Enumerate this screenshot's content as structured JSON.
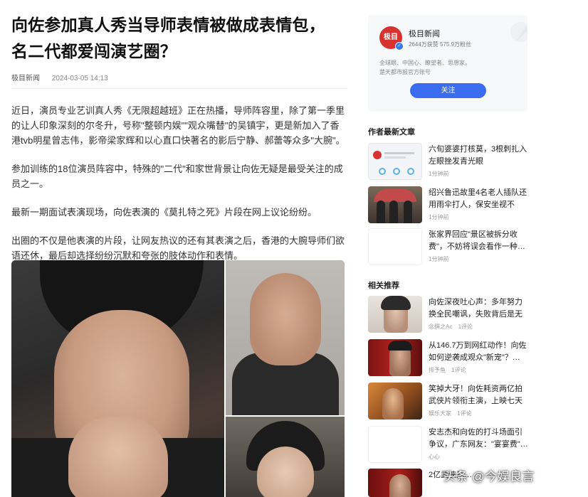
{
  "article": {
    "title_line1": "向佐参加真人秀当导师表情被做成表情包，",
    "title_line2": "名二代都爱闯演艺圈？",
    "source": "极目新闻",
    "date": "2024-03-05 14:13",
    "paragraphs": [
      "近日，演员专业艺训真人秀《无限超越班》正在热播，导师阵容里，除了第一季里的让人印象深刻的尔冬升，号称\"整顿内娱\"\"观众嘴替\"的吴镇宇，更是新加入了香港tvb明星曾志伟，影帝梁家辉和以心直口快著名的影后宁静、郝蕾等众多\"大腕\"。",
      "参加训练的18位演员阵容中，特殊的\"二代\"和家世背景让向佐无疑是最受关注的成员之一。",
      "最新一期面试表演现场，向佐表演的《莫扎特之死》片段在网上议论纷纷。",
      "出圈的不仅是他表演的片段，让网友热议的还有其表演之后，香港的大腕导师们欲语还休，最后却选择纷纷沉默和夸张的肢体动作和表情。"
    ]
  },
  "author_card": {
    "logo_text": "极目",
    "name": "极目新闻",
    "stats": "2644万获赞 575.9万粉丝",
    "desc_line1": "全球眼、中国心、瞭望者、思想家。",
    "desc_line2": "楚天都市报官方账号",
    "follow_label": "关注"
  },
  "latest": {
    "heading": "作者最新文章",
    "items": [
      {
        "title": "六旬婆婆打核莫，3根刺扎入左眼挫发青光眼",
        "time": "1分钟前"
      },
      {
        "title": "绍兴鲁迅故里4名老人插队还用雨伞打人，保安坐视不管…",
        "time": "1分钟前"
      },
      {
        "title": "张家界回应\"景区被拆分收费\"，不妨将误会看作一种…",
        "time": "1分钟前"
      }
    ]
  },
  "related": {
    "heading": "相关推荐",
    "items": [
      {
        "title": "向佐深夜吐心声：多年努力换全民嘲讽，失败背后是无尽…",
        "author": "念撰之Ac",
        "comments": "1评论"
      },
      {
        "title": "从146.7万到网红动作！向佐如何逆袭成观众\"新宠\"？…",
        "author": "排予鱼",
        "comments": "1评论"
      },
      {
        "title": "笑掉大牙！向佐耗资两亿拍武侠片领衔主演，上映七天竟…",
        "author": "娱乐大家",
        "comments": "1评论"
      },
      {
        "title": "安志杰和向佐的打斗场面引争议，广东网友：\"宴宴费\"…",
        "author": "心心",
        "comments": ""
      },
      {
        "title": "2亿武侠片…",
        "author": "",
        "comments": ""
      }
    ]
  },
  "watermark": "头条 @今娱良言"
}
